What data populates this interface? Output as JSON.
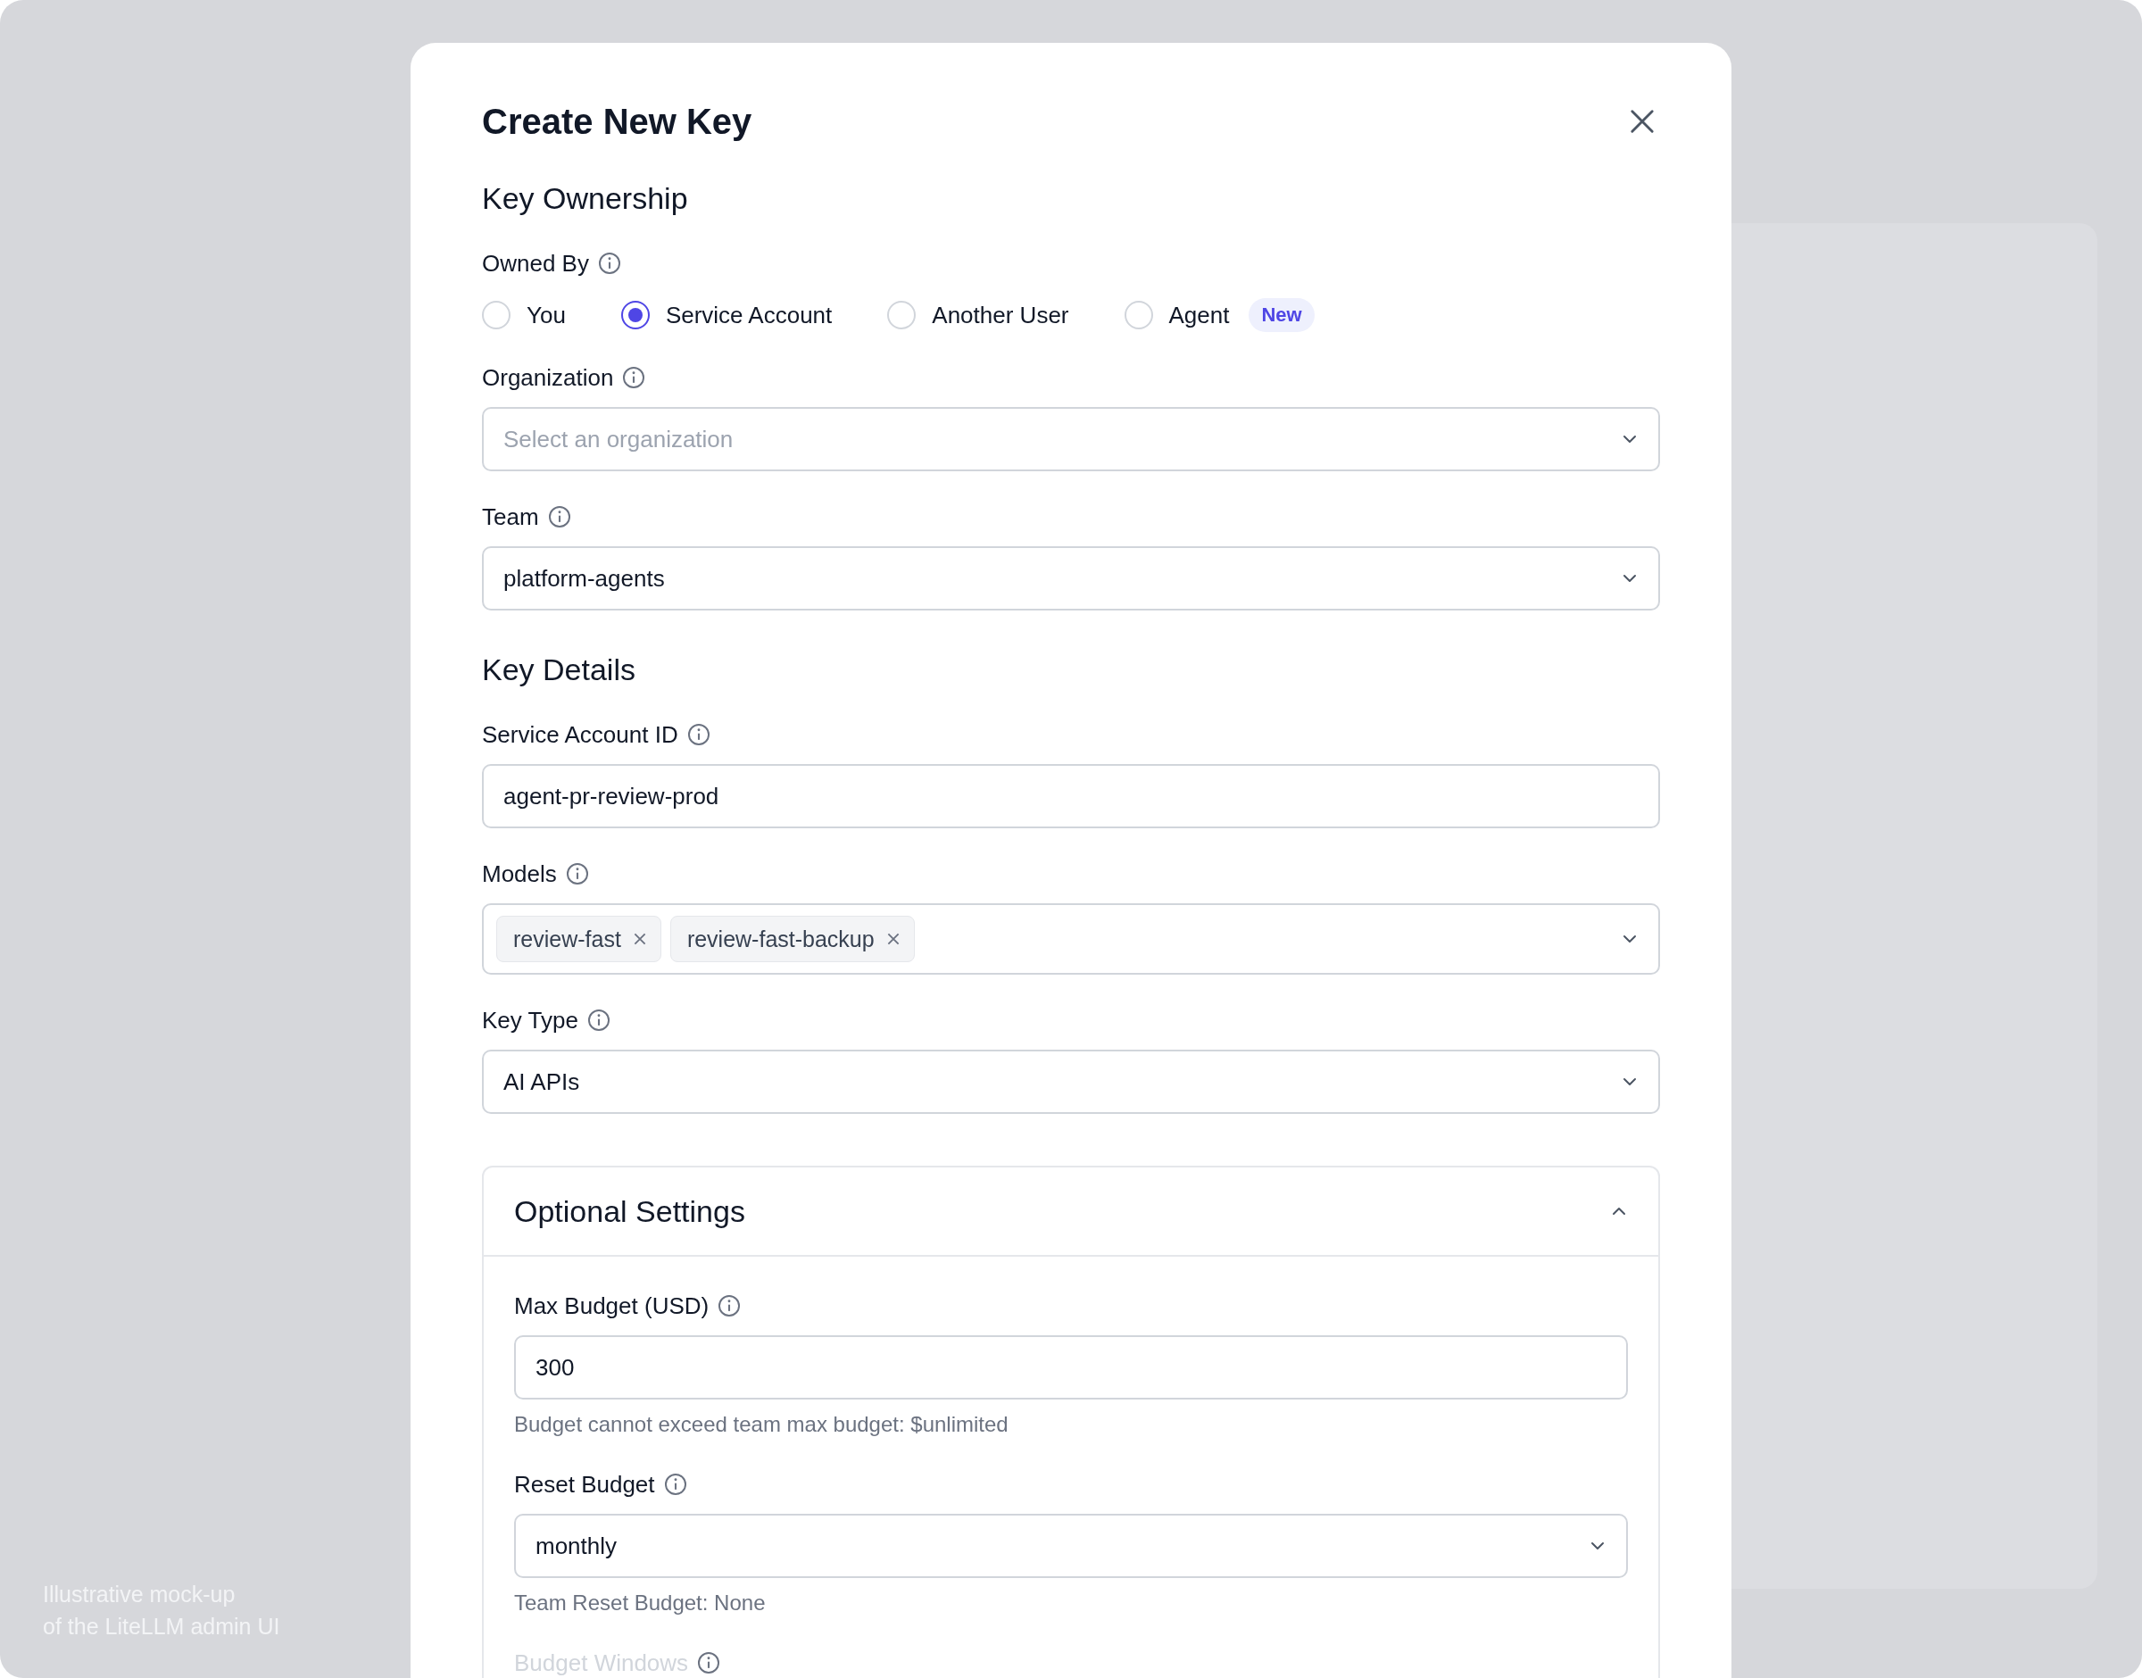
{
  "modal": {
    "title": "Create New Key"
  },
  "ownership": {
    "heading": "Key Ownership",
    "owned_by": {
      "label": "Owned By",
      "options": [
        {
          "label": "You",
          "selected": false
        },
        {
          "label": "Service Account",
          "selected": true
        },
        {
          "label": "Another User",
          "selected": false
        },
        {
          "label": "Agent",
          "selected": false,
          "badge": "New"
        }
      ]
    },
    "fields": [
      {
        "kind": "select",
        "label": "Organization",
        "placeholder": "Select an organization"
      },
      {
        "kind": "select",
        "label": "Team",
        "value": "platform-agents"
      }
    ]
  },
  "details": {
    "heading": "Key Details",
    "fields": [
      {
        "kind": "input",
        "label": "Service Account ID",
        "value": "agent-pr-review-prod"
      },
      {
        "kind": "tags",
        "label": "Models",
        "tags": [
          "review-fast",
          "review-fast-backup"
        ]
      },
      {
        "kind": "select",
        "label": "Key Type",
        "value": "AI APIs"
      }
    ]
  },
  "optional_settings": {
    "title": "Optional Settings",
    "expanded": true,
    "fields": [
      {
        "kind": "input",
        "label": "Max Budget (USD)",
        "value": "300",
        "help": "Budget cannot exceed team max budget: $unlimited"
      },
      {
        "kind": "select",
        "label": "Reset Budget",
        "value": "monthly",
        "help": "Team Reset Budget: None"
      },
      {
        "kind": "faded",
        "label": "Budget Windows"
      }
    ]
  },
  "caption": [
    "Illustrative mock-up",
    "of the LiteLLM admin UI"
  ]
}
